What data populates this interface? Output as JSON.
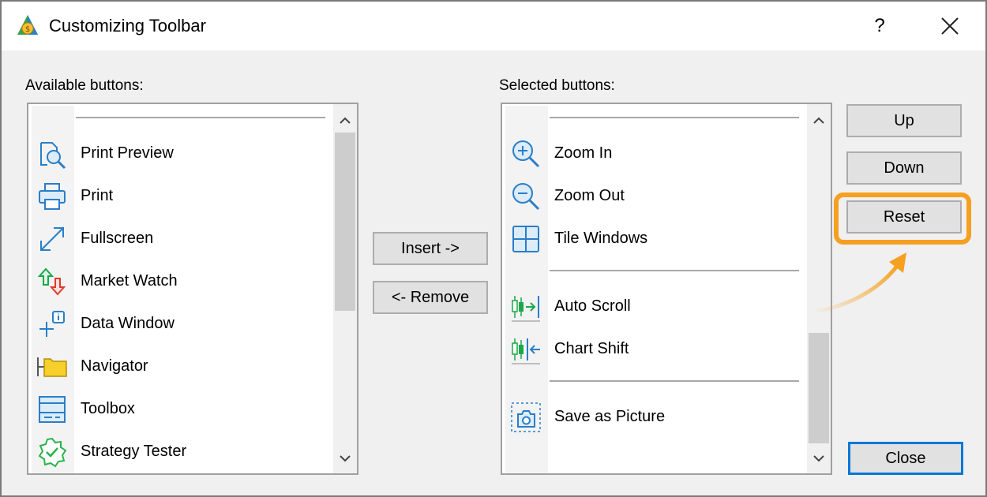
{
  "dialog": {
    "title": "Customizing Toolbar",
    "help_label": "?"
  },
  "available": {
    "label": "Available buttons:",
    "items": [
      {
        "label": "Print Preview",
        "icon": "print-preview-icon"
      },
      {
        "label": "Print",
        "icon": "printer-icon"
      },
      {
        "label": "Fullscreen",
        "icon": "fullscreen-icon"
      },
      {
        "label": "Market Watch",
        "icon": "market-watch-icon"
      },
      {
        "label": "Data Window",
        "icon": "data-window-icon"
      },
      {
        "label": "Navigator",
        "icon": "navigator-folder-icon"
      },
      {
        "label": "Toolbox",
        "icon": "toolbox-icon"
      },
      {
        "label": "Strategy Tester",
        "icon": "strategy-tester-icon"
      }
    ]
  },
  "selected": {
    "label": "Selected buttons:",
    "items": [
      {
        "label": "Zoom In",
        "icon": "zoom-in-icon"
      },
      {
        "label": "Zoom Out",
        "icon": "zoom-out-icon"
      },
      {
        "label": "Tile Windows",
        "icon": "tile-windows-icon"
      },
      {
        "label": "Auto Scroll",
        "icon": "auto-scroll-icon"
      },
      {
        "label": "Chart Shift",
        "icon": "chart-shift-icon"
      },
      {
        "label": "Save as Picture",
        "icon": "camera-icon"
      }
    ]
  },
  "buttons": {
    "insert": "Insert ->",
    "remove": "<- Remove",
    "up": "Up",
    "down": "Down",
    "reset": "Reset",
    "close": "Close"
  },
  "colors": {
    "icon_blue": "#2a7ec8",
    "market_up": "#1aa84a",
    "market_down": "#e03a2a",
    "navigator_yellow": "#f7cf2a",
    "strategy_green": "#2bb34a",
    "chart_green": "#1aa84a",
    "highlight_orange": "#f5a020",
    "default_border": "#0078d7"
  }
}
